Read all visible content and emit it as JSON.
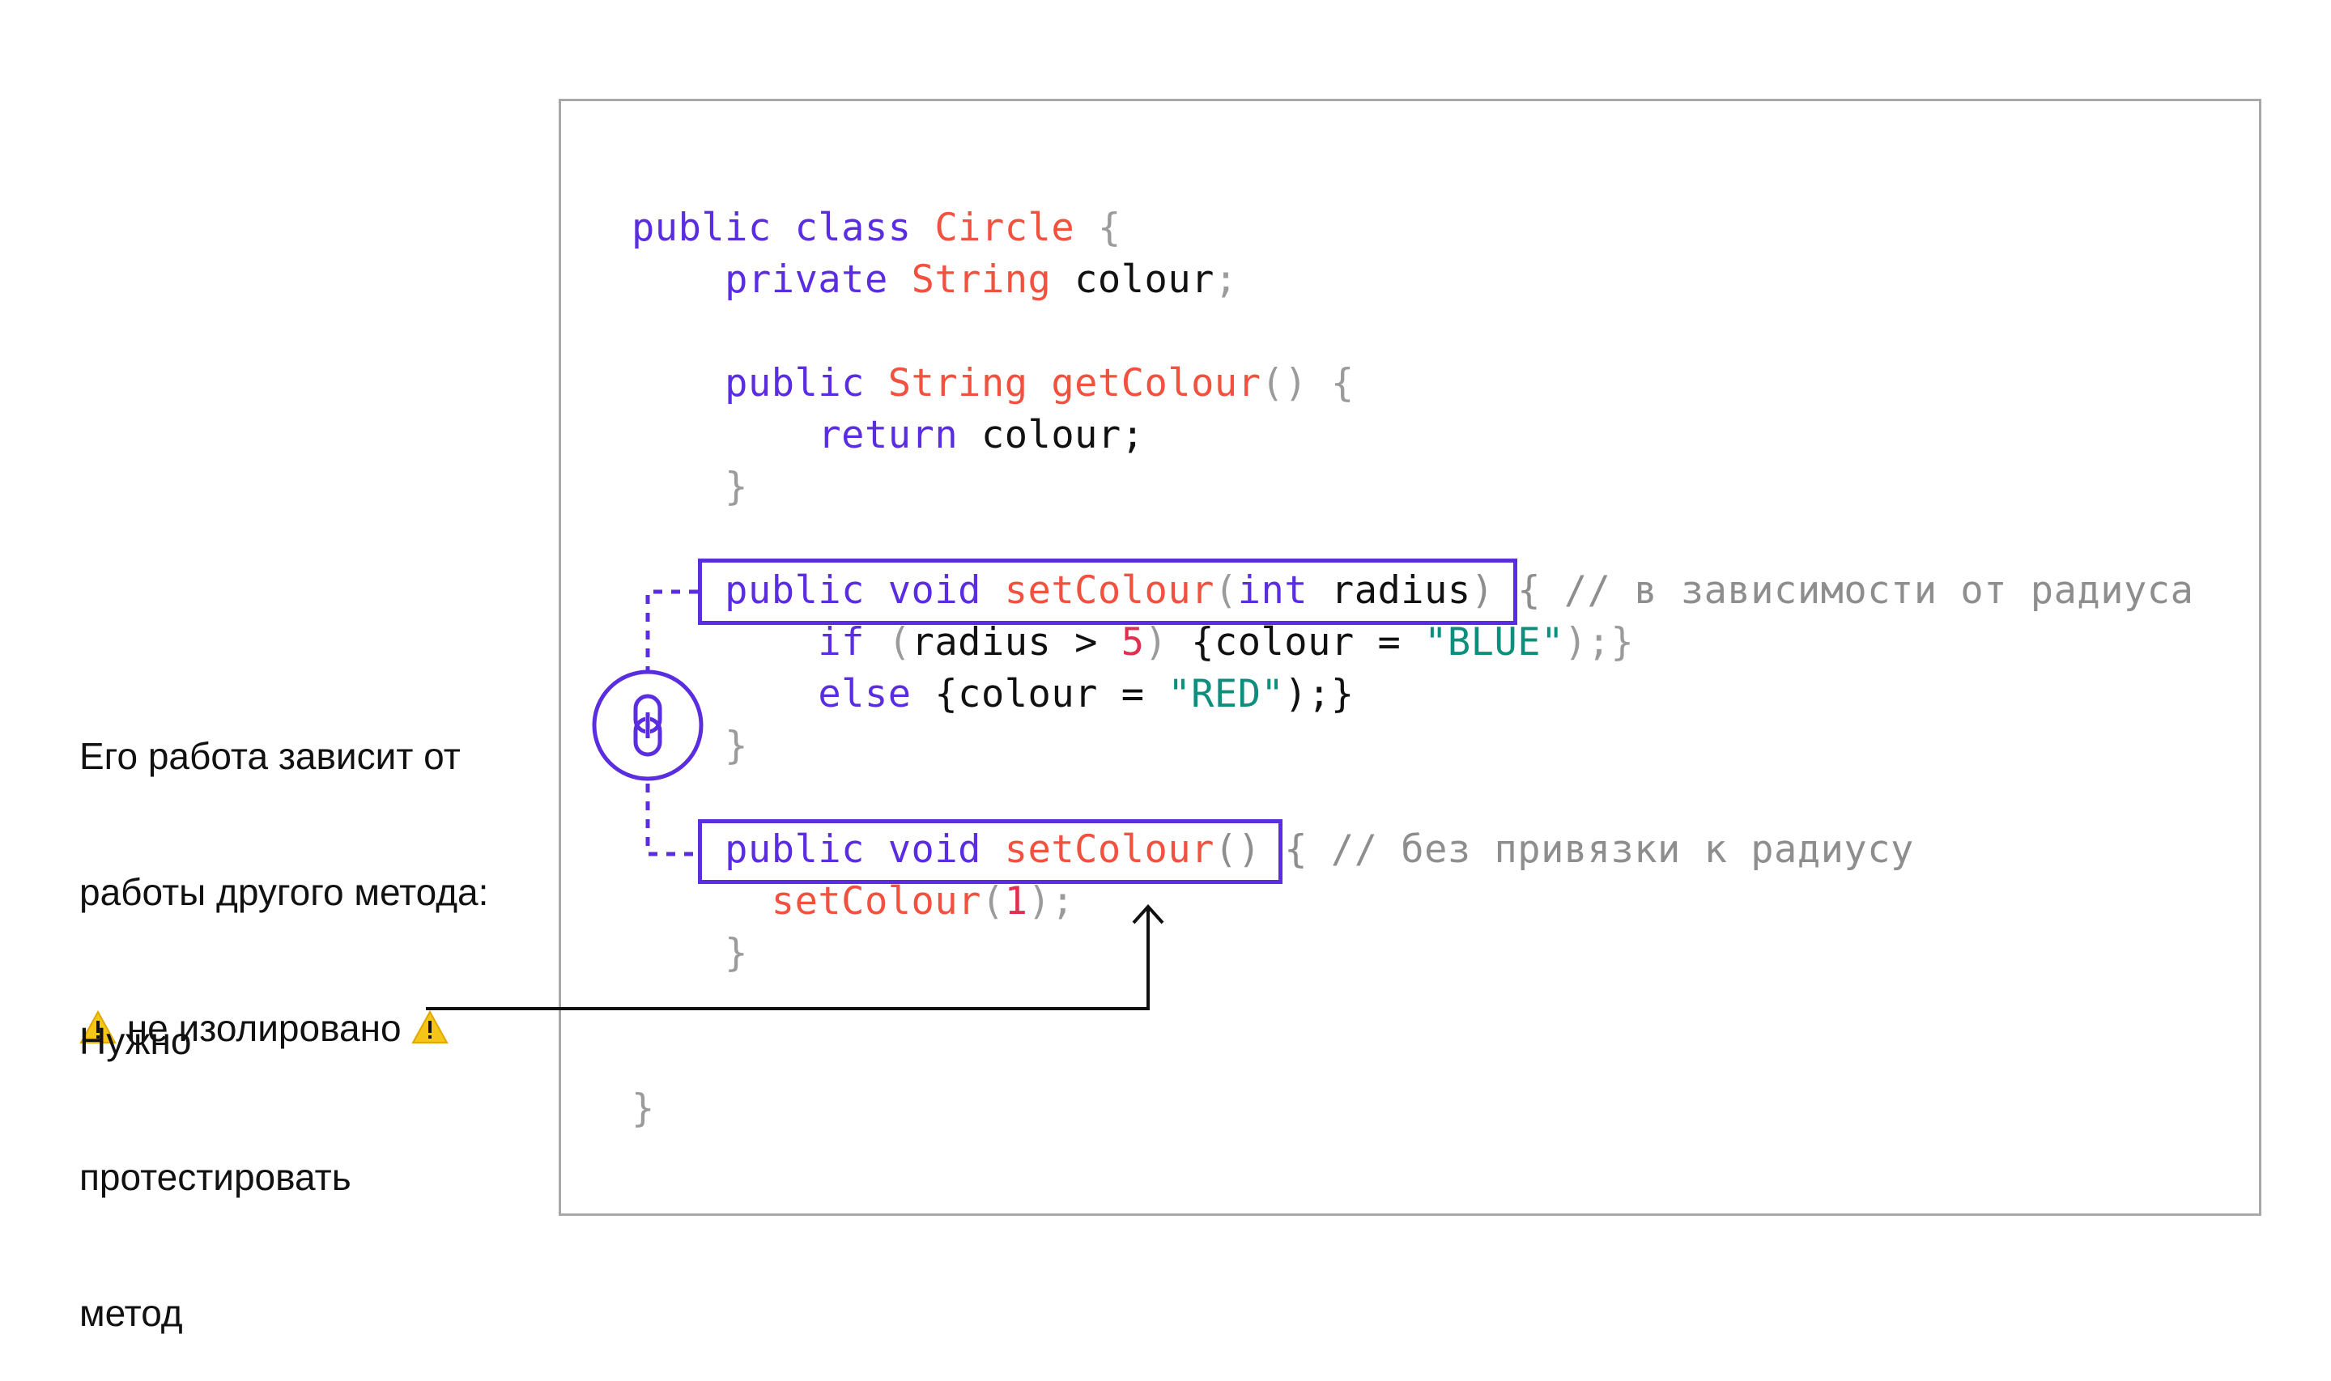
{
  "code": {
    "lines": [
      [
        {
          "t": "public class ",
          "c": "kw"
        },
        {
          "t": "Circle ",
          "c": "type"
        },
        {
          "t": "{",
          "c": "punc"
        }
      ],
      [
        {
          "t": "    private ",
          "c": "kw"
        },
        {
          "t": "String ",
          "c": "type"
        },
        {
          "t": "colour",
          "c": "plain"
        },
        {
          "t": ";",
          "c": "punc"
        }
      ],
      [],
      [
        {
          "t": "    public ",
          "c": "kw"
        },
        {
          "t": "String ",
          "c": "type"
        },
        {
          "t": "getColour",
          "c": "type"
        },
        {
          "t": "() {",
          "c": "punc"
        }
      ],
      [
        {
          "t": "        return ",
          "c": "kw"
        },
        {
          "t": "colour;",
          "c": "plain"
        }
      ],
      [
        {
          "t": "    }",
          "c": "punc"
        }
      ],
      [],
      [
        {
          "t": "    public void ",
          "c": "kw"
        },
        {
          "t": "setColour",
          "c": "type"
        },
        {
          "t": "(",
          "c": "punc"
        },
        {
          "t": "int ",
          "c": "kw"
        },
        {
          "t": "radius",
          "c": "plain"
        },
        {
          "t": ") { // в зависимости от радиуса",
          "c": "com"
        }
      ],
      [
        {
          "t": "        if ",
          "c": "kw"
        },
        {
          "t": "(",
          "c": "punc"
        },
        {
          "t": "radius > ",
          "c": "plain"
        },
        {
          "t": "5",
          "c": "num"
        },
        {
          "t": ") ",
          "c": "punc"
        },
        {
          "t": "{colour = ",
          "c": "plain"
        },
        {
          "t": "\"BLUE\"",
          "c": "str"
        },
        {
          "t": ");}",
          "c": "punc"
        }
      ],
      [
        {
          "t": "        else ",
          "c": "kw"
        },
        {
          "t": "{colour = ",
          "c": "plain"
        },
        {
          "t": "\"RED\"",
          "c": "str"
        },
        {
          "t": ");}",
          "c": "plain"
        }
      ],
      [
        {
          "t": "    }",
          "c": "punc"
        }
      ],
      [],
      [
        {
          "t": "    public void ",
          "c": "kw"
        },
        {
          "t": "setColour",
          "c": "type"
        },
        {
          "t": "() { // без привязки к радиусу",
          "c": "com"
        }
      ],
      [
        {
          "t": "      setColour",
          "c": "type"
        },
        {
          "t": "(",
          "c": "punc"
        },
        {
          "t": "1",
          "c": "num"
        },
        {
          "t": ");",
          "c": "punc"
        }
      ],
      [
        {
          "t": "    }",
          "c": "punc"
        }
      ],
      [],
      [],
      [
        {
          "t": "}",
          "c": "punc"
        }
      ]
    ]
  },
  "annotations": {
    "dependency_note_line1": "Его работа зависит от",
    "dependency_note_line2": "работы другого метода:",
    "dependency_note_line3": " не изолировано ",
    "test_note_line1": "Нужно",
    "test_note_line2": "протестировать",
    "test_note_line3": "метод"
  },
  "colors": {
    "accent": "#5b2de0",
    "type": "#f0523f",
    "string": "#0e8f7e",
    "number": "#e0304f",
    "comment": "#8e8e8e",
    "frame": "#a8a8a8",
    "warning": "#f5c518"
  },
  "icons": {
    "link": "link-icon",
    "warning": "warning-icon",
    "arrow": "arrow-up-icon"
  }
}
